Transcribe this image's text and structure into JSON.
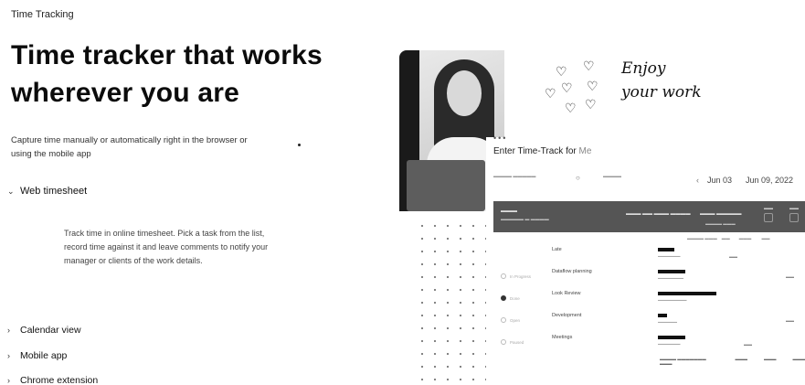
{
  "eyebrow": "Time Tracking",
  "headline": "Time tracker that works wherever you are",
  "subtitle": "Capture time manually or automatically right in the browser or using the mobile app",
  "accordion": {
    "open": {
      "label": "Web timesheet",
      "body": "Track time in online timesheet. Pick a task from the list, record time against it and leave comments to notify your manager or clients of the work details."
    },
    "collapsed": [
      {
        "label": "Calendar view"
      },
      {
        "label": "Mobile app"
      },
      {
        "label": "Chrome extension"
      }
    ]
  },
  "handwriting": {
    "line1": "Enjoy",
    "line2": "your work"
  },
  "app": {
    "title": "Enter Time-Track for",
    "user": "Me",
    "date_from": "Jun 03",
    "date_to": "Jun 09, 2022",
    "rows": [
      {
        "task": "Late",
        "status": ""
      },
      {
        "task": "Dataflow planning",
        "status": "In Progress"
      },
      {
        "task": "Look Review",
        "status": "Done"
      },
      {
        "task": "Development",
        "status": "Open"
      },
      {
        "task": "Meetings",
        "status": "Paused"
      }
    ]
  },
  "colors": {
    "text": "#111111",
    "muted": "#444444",
    "bar": "#555555"
  }
}
